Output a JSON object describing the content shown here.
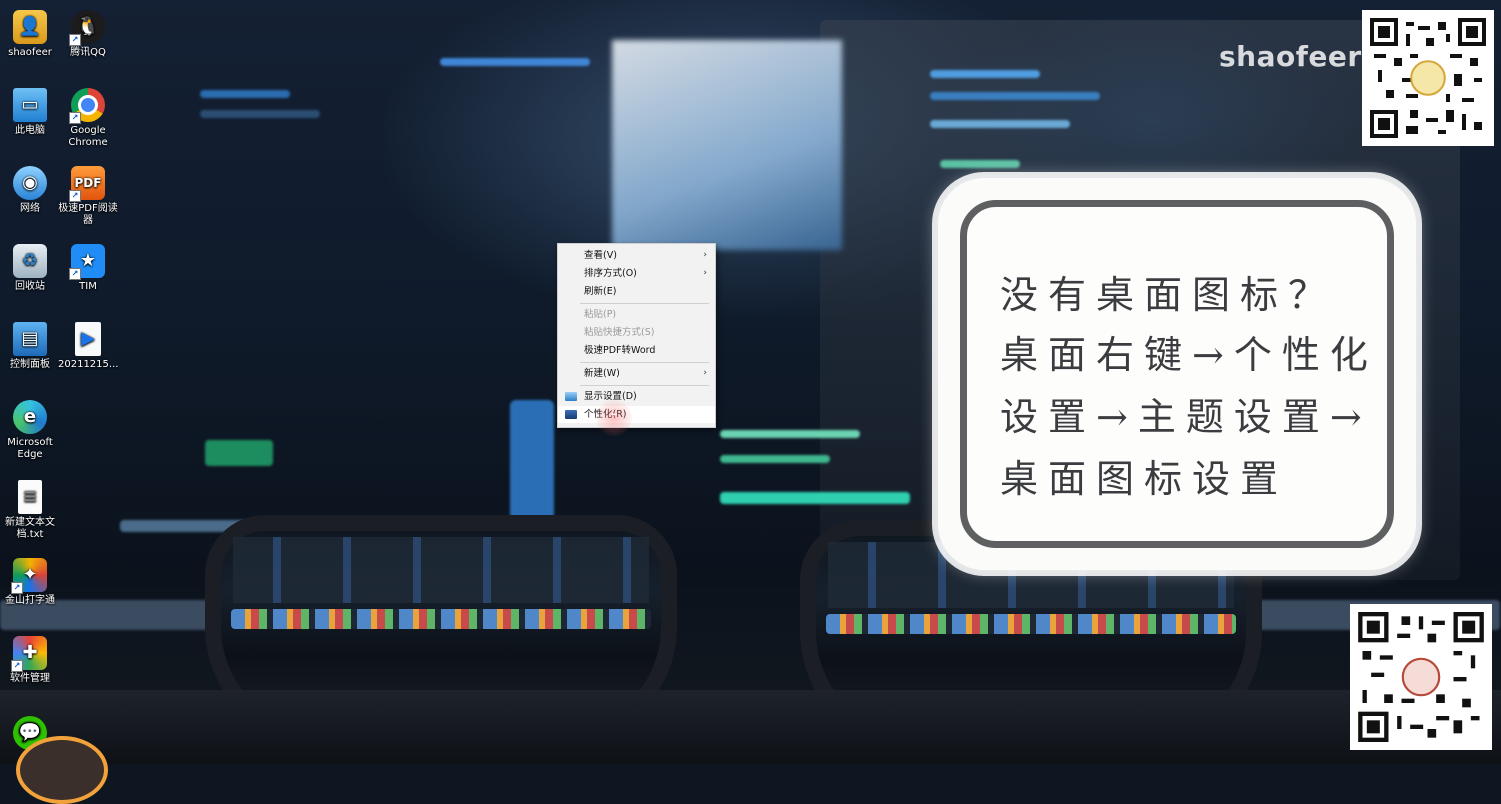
{
  "desktop_icons": [
    {
      "label": "shaofeer",
      "icon": "user-folder-icon"
    },
    {
      "label": "腾讯QQ",
      "icon": "qq-penguin-icon"
    },
    {
      "label": "此电脑",
      "icon": "this-pc-icon"
    },
    {
      "label": "Google Chrome",
      "icon": "chrome-icon"
    },
    {
      "label": "网络",
      "icon": "network-icon"
    },
    {
      "label": "极速PDF阅读器",
      "icon": "pdf-reader-icon"
    },
    {
      "label": "回收站",
      "icon": "recycle-bin-icon"
    },
    {
      "label": "TIM",
      "icon": "tim-star-icon"
    },
    {
      "label": "控制面板",
      "icon": "control-panel-icon"
    },
    {
      "label": "20211215...",
      "icon": "video-file-icon"
    },
    {
      "label": "Microsoft Edge",
      "icon": "edge-icon"
    },
    {
      "label": "新建文本文档.txt",
      "icon": "text-file-icon"
    },
    {
      "label": "金山打字通",
      "icon": "typing-app-icon"
    },
    {
      "label": "软件管理",
      "icon": "software-manager-icon"
    }
  ],
  "context_menu": {
    "items": [
      {
        "label": "查看(V)",
        "submenu": true,
        "disabled": false
      },
      {
        "label": "排序方式(O)",
        "submenu": true,
        "disabled": false
      },
      {
        "label": "刷新(E)",
        "submenu": false,
        "disabled": false
      },
      {
        "label": "粘贴(P)",
        "submenu": false,
        "disabled": true
      },
      {
        "label": "粘贴快捷方式(S)",
        "submenu": false,
        "disabled": true
      },
      {
        "label": "极速PDF转Word",
        "submenu": false,
        "disabled": false
      },
      {
        "label": "新建(W)",
        "submenu": true,
        "disabled": false
      },
      {
        "label": "显示设置(D)",
        "submenu": false,
        "disabled": false,
        "icon": "display-settings-icon"
      },
      {
        "label": "个性化(R)",
        "submenu": false,
        "disabled": false,
        "icon": "personalize-icon",
        "hovered": true
      }
    ],
    "submenu_arrow": "›"
  },
  "watermark": "shaofeer",
  "hint_card": {
    "lines": [
      "没有桌面图标？",
      "桌面右键→个性化",
      "设置→主题设置→",
      "桌面图标设置"
    ]
  },
  "colors": {
    "menu_bg": "#f2f2f2",
    "card_border": "#5d5f61",
    "card_text": "#3a3c3f"
  }
}
